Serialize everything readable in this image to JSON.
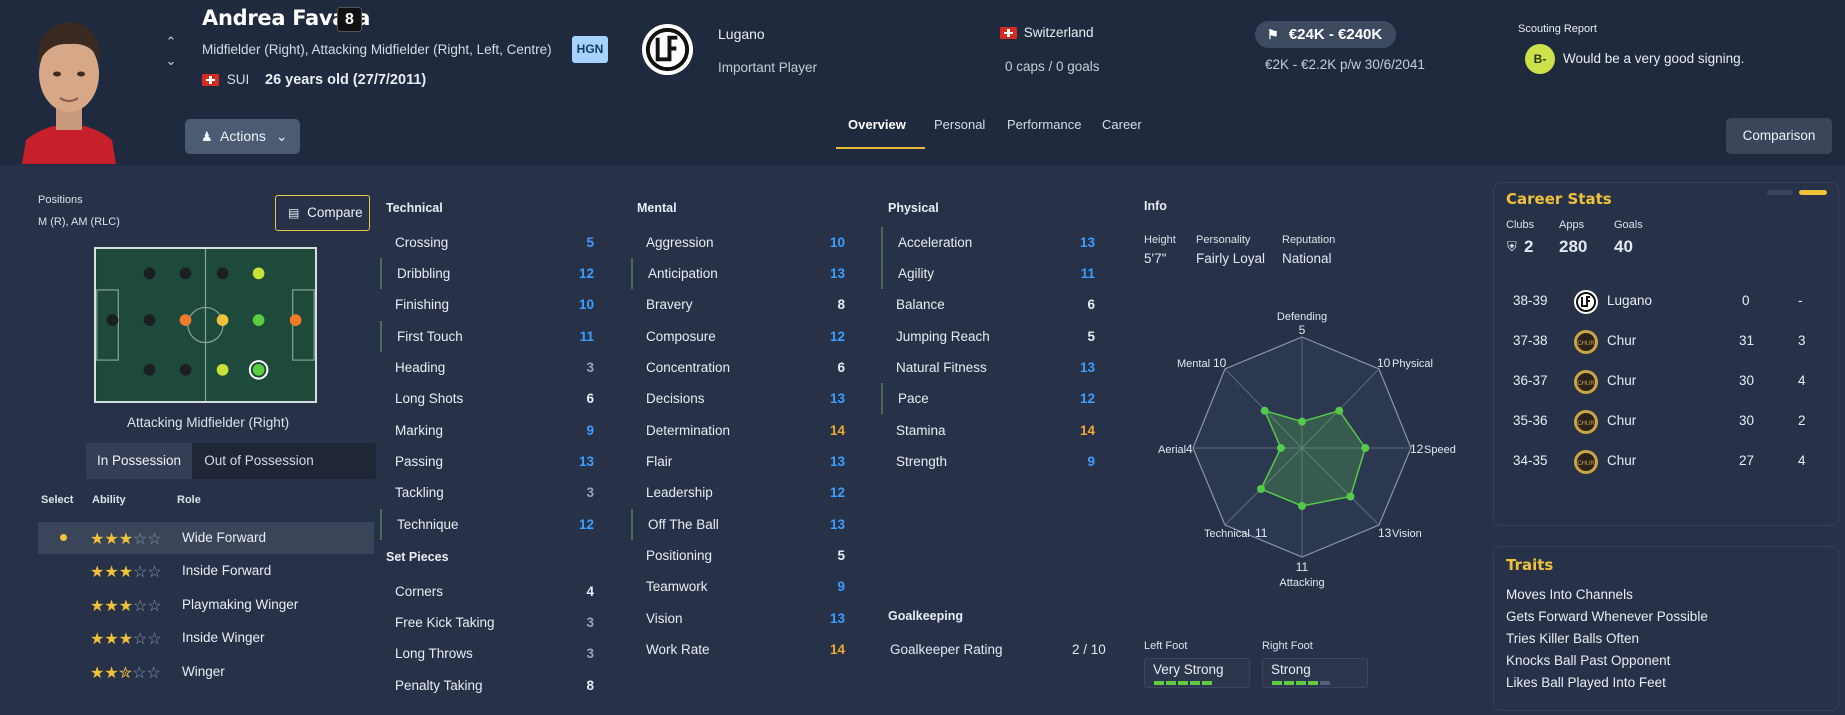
{
  "player": {
    "name": "Andrea Favara",
    "number": "8",
    "positions_long": "Midfielder (Right), Attacking Midfielder (Right, Left, Centre)",
    "nationality_code": "SUI",
    "age_text": "26 years old (27/7/2011)",
    "hgn": "HGN",
    "club": "Lugano",
    "squad_status": "Important Player",
    "country": "Switzerland",
    "caps": "0 caps / 0 goals",
    "value": "€24K - €240K",
    "wage": "€2K - €2.2K p/w  30/6/2041"
  },
  "scouting": {
    "title": "Scouting Report",
    "grade": "B-",
    "text": "Would be a very good signing."
  },
  "nav": {
    "actions": "Actions",
    "comparison": "Comparison",
    "compare": "Compare",
    "tabs": [
      {
        "label": "Overview"
      },
      {
        "label": "Personal"
      },
      {
        "label": "Performance"
      },
      {
        "label": "Career"
      }
    ]
  },
  "positions": {
    "label": "Positions",
    "value": "M (R), AM (RLC)",
    "caption": "Attacking Midfielder (Right)"
  },
  "possession": {
    "in": "In Possession",
    "out": "Out of Possession"
  },
  "roles": {
    "headers": {
      "select": "Select",
      "ability": "Ability",
      "role": "Role"
    },
    "items": [
      {
        "name": "Wide Forward",
        "stars": 3,
        "selected": true
      },
      {
        "name": "Inside Forward",
        "stars": 3
      },
      {
        "name": "Playmaking Winger",
        "stars": 3
      },
      {
        "name": "Inside Winger",
        "stars": 3
      },
      {
        "name": "Winger",
        "stars": 2.5
      }
    ]
  },
  "technical": {
    "title": "Technical",
    "items": [
      {
        "name": "Crossing",
        "value": "5"
      },
      {
        "name": "Dribbling",
        "value": "12"
      },
      {
        "name": "Finishing",
        "value": "10"
      },
      {
        "name": "First Touch",
        "value": "11"
      },
      {
        "name": "Heading",
        "value": "3"
      },
      {
        "name": "Long Shots",
        "value": "6"
      },
      {
        "name": "Marking",
        "value": "9"
      },
      {
        "name": "Passing",
        "value": "13"
      },
      {
        "name": "Tackling",
        "value": "3"
      },
      {
        "name": "Technique",
        "value": "12"
      }
    ]
  },
  "set_pieces": {
    "title": "Set Pieces",
    "items": [
      {
        "name": "Corners",
        "value": "4"
      },
      {
        "name": "Free Kick Taking",
        "value": "3"
      },
      {
        "name": "Long Throws",
        "value": "3"
      },
      {
        "name": "Penalty Taking",
        "value": "8"
      }
    ]
  },
  "mental": {
    "title": "Mental",
    "items": [
      {
        "name": "Aggression",
        "value": "10"
      },
      {
        "name": "Anticipation",
        "value": "13"
      },
      {
        "name": "Bravery",
        "value": "8"
      },
      {
        "name": "Composure",
        "value": "12"
      },
      {
        "name": "Concentration",
        "value": "6"
      },
      {
        "name": "Decisions",
        "value": "13"
      },
      {
        "name": "Determination",
        "value": "14"
      },
      {
        "name": "Flair",
        "value": "13"
      },
      {
        "name": "Leadership",
        "value": "12"
      },
      {
        "name": "Off The Ball",
        "value": "13"
      },
      {
        "name": "Positioning",
        "value": "5"
      },
      {
        "name": "Teamwork",
        "value": "9"
      },
      {
        "name": "Vision",
        "value": "13"
      },
      {
        "name": "Work Rate",
        "value": "14"
      }
    ]
  },
  "physical": {
    "title": "Physical",
    "items": [
      {
        "name": "Acceleration",
        "value": "13"
      },
      {
        "name": "Agility",
        "value": "11"
      },
      {
        "name": "Balance",
        "value": "6"
      },
      {
        "name": "Jumping Reach",
        "value": "5"
      },
      {
        "name": "Natural Fitness",
        "value": "13"
      },
      {
        "name": "Pace",
        "value": "12"
      },
      {
        "name": "Stamina",
        "value": "14"
      },
      {
        "name": "Strength",
        "value": "9"
      }
    ]
  },
  "goalkeeping": {
    "title": "Goalkeeping",
    "label": "Goalkeeper Rating",
    "value": "2 / 10"
  },
  "info": {
    "title": "Info",
    "height_label": "Height",
    "height": "5'7\"",
    "personality_label": "Personality",
    "personality": "Fairly Loyal",
    "reputation_label": "Reputation",
    "reputation": "National",
    "left_foot_label": "Left Foot",
    "left_foot": "Very Strong",
    "left_foot_level": 5,
    "right_foot_label": "Right Foot",
    "right_foot": "Strong",
    "right_foot_level": 4
  },
  "radar": {
    "labels": [
      {
        "name": "Defending",
        "value": "5"
      },
      {
        "name": "Physical",
        "value": "10"
      },
      {
        "name": "Speed",
        "value": "12"
      },
      {
        "name": "Vision",
        "value": "13"
      },
      {
        "name": "Attacking",
        "value": "11"
      },
      {
        "name": "Technical",
        "value": "11"
      },
      {
        "name": "Aerial",
        "value": "4"
      },
      {
        "name": "Mental",
        "value": "10"
      }
    ]
  },
  "career": {
    "title": "Career Stats",
    "clubs_label": "Clubs",
    "clubs": "2",
    "apps_label": "Apps",
    "apps": "280",
    "goals_label": "Goals",
    "goals": "40",
    "rows": [
      {
        "season": "38-39",
        "club": "Lugano",
        "apps": "0",
        "goals": "-"
      },
      {
        "season": "37-38",
        "club": "Chur",
        "apps": "31",
        "goals": "3"
      },
      {
        "season": "36-37",
        "club": "Chur",
        "apps": "30",
        "goals": "4"
      },
      {
        "season": "35-36",
        "club": "Chur",
        "apps": "30",
        "goals": "2"
      },
      {
        "season": "34-35",
        "club": "Chur",
        "apps": "27",
        "goals": "4"
      }
    ]
  },
  "traits": {
    "title": "Traits",
    "items": [
      "Moves Into Channels",
      "Gets Forward Whenever Possible",
      "Tries Killer Balls Often",
      "Knocks Ball Past Opponent",
      "Likes Ball Played Into Feet"
    ]
  },
  "colors": {
    "accent": "#f0c23a",
    "blue_value": "#3f9dff",
    "orange_value": "#f0a930",
    "radar_green": "#56c94a"
  }
}
